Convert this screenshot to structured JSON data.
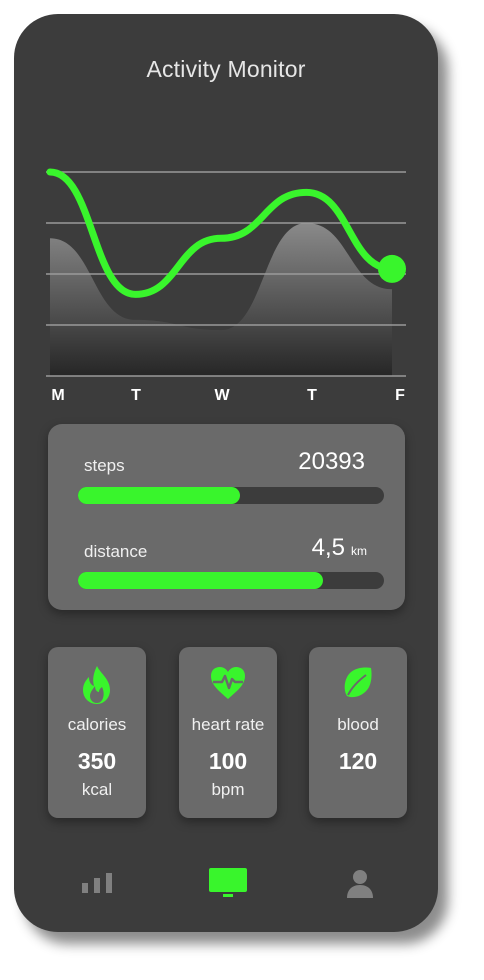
{
  "app": {
    "title": "Activity Monitor"
  },
  "colors": {
    "accent": "#39f52c",
    "background": "#3c3c3c",
    "card": "#6a6a6a",
    "muted": "#808080"
  },
  "chart_data": {
    "type": "line",
    "x": [
      "M",
      "T",
      "W",
      "T",
      "F"
    ],
    "x_tick_labels": [
      "M",
      "T",
      "W",
      "T",
      "F"
    ],
    "series": [
      {
        "values": [
          4.0,
          1.6,
          2.7,
          3.6,
          2.1
        ]
      },
      {
        "values": [
          2.7,
          1.1,
          0.9,
          3.0,
          1.7
        ]
      }
    ],
    "ylim": [
      0,
      4
    ],
    "grid": true
  },
  "metrics": {
    "steps": {
      "label": "steps",
      "value": "20393",
      "progress": 0.53
    },
    "distance": {
      "label": "distance",
      "value": "4,5",
      "unit": "km",
      "progress": 0.8
    }
  },
  "tiles": [
    {
      "icon": "flame-icon",
      "label": "calories",
      "value": "350",
      "unit": "kcal"
    },
    {
      "icon": "heart-pulse-icon",
      "label": "heart rate",
      "value": "100",
      "unit": "bpm"
    },
    {
      "icon": "blood-drop-icon",
      "label": "blood",
      "value": "120",
      "unit": ""
    }
  ],
  "nav": [
    {
      "icon": "bar-chart-icon",
      "active": false
    },
    {
      "icon": "monitor-icon",
      "active": true
    },
    {
      "icon": "user-icon",
      "active": false
    }
  ]
}
